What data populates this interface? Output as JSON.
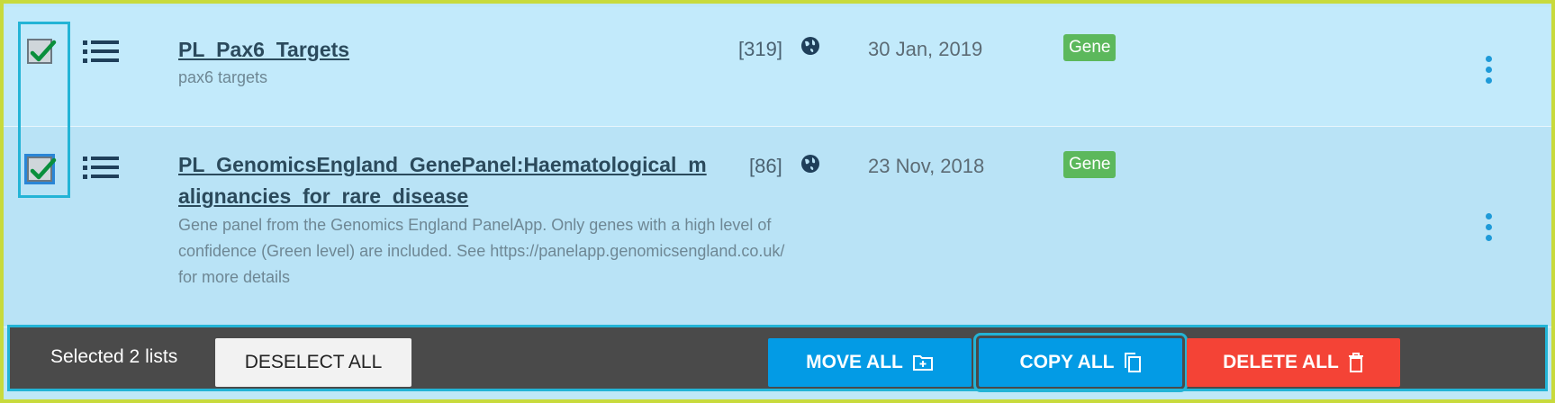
{
  "rows": [
    {
      "title": "PL_Pax6_Targets",
      "description_lines": [
        "pax6 targets"
      ],
      "count": "[319]",
      "date": "30 Jan, 2019",
      "badge": "Gene",
      "checked": true
    },
    {
      "title_line1": "PL_GenomicsEngland_GenePanel:Haematological_m",
      "title_line2": "alignancies_for_rare_disease",
      "description_lines": [
        "Gene panel from the Genomics England PanelApp. Only genes with a high level of",
        "confidence (Green level) are included. See https://panelapp.genomicsengland.co.uk/",
        "for more details"
      ],
      "count": "[86]",
      "date": "23 Nov, 2018",
      "badge": "Gene",
      "checked": true
    }
  ],
  "selection_bar": {
    "status_text": "Selected 2 lists",
    "deselect_label": "DESELECT ALL",
    "move_label": "MOVE ALL",
    "copy_label": "COPY ALL",
    "delete_label": "DELETE ALL"
  },
  "colors": {
    "accent_blue": "#039be5",
    "danger_red": "#f44336",
    "badge_green": "#5cb85c",
    "highlight": "#23b4d6"
  },
  "icons": [
    "list-icon",
    "globe-icon",
    "kebab-menu-icon",
    "folder-plus-icon",
    "copy-icon",
    "trash-icon",
    "check-icon"
  ]
}
